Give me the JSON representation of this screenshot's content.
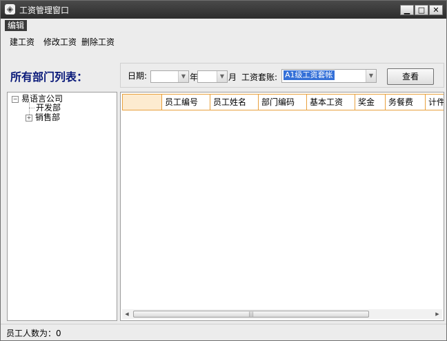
{
  "window": {
    "title": "工资管理窗口",
    "icon": "app-logo-icon",
    "controls": {
      "minimize": "▁",
      "maximize": "□",
      "close": "✕"
    }
  },
  "menubar": {
    "items": [
      {
        "label": "编辑"
      }
    ]
  },
  "toolbar": {
    "create": "建工资",
    "modify": "修改工资",
    "delete": "删除工资"
  },
  "departments": {
    "heading": "所有部门列表：",
    "tree": {
      "root": {
        "label": "易语言公司",
        "expander": "−"
      },
      "children": [
        {
          "label": "开发部",
          "expander": ""
        },
        {
          "label": "销售部",
          "expander": "+"
        }
      ]
    }
  },
  "filter": {
    "date_label": "日期:",
    "year_value": "",
    "year_label": "年",
    "month_value": "",
    "month_label": "月",
    "ledger_label": "工资套账:",
    "ledger_value": "A1级工资套帐",
    "view_button": "查看"
  },
  "grid": {
    "columns": [
      "",
      "员工编号",
      "员工姓名",
      "部门编码",
      "基本工资",
      "奖金",
      "务餐费",
      "计件"
    ],
    "rows": [],
    "header_color": "#fdebd0",
    "border_color": "#e8a03c"
  },
  "status": {
    "employee_count": "员工人数为：0"
  },
  "colors": {
    "accent": "#3470d8",
    "heading": "#0a1a7a"
  }
}
